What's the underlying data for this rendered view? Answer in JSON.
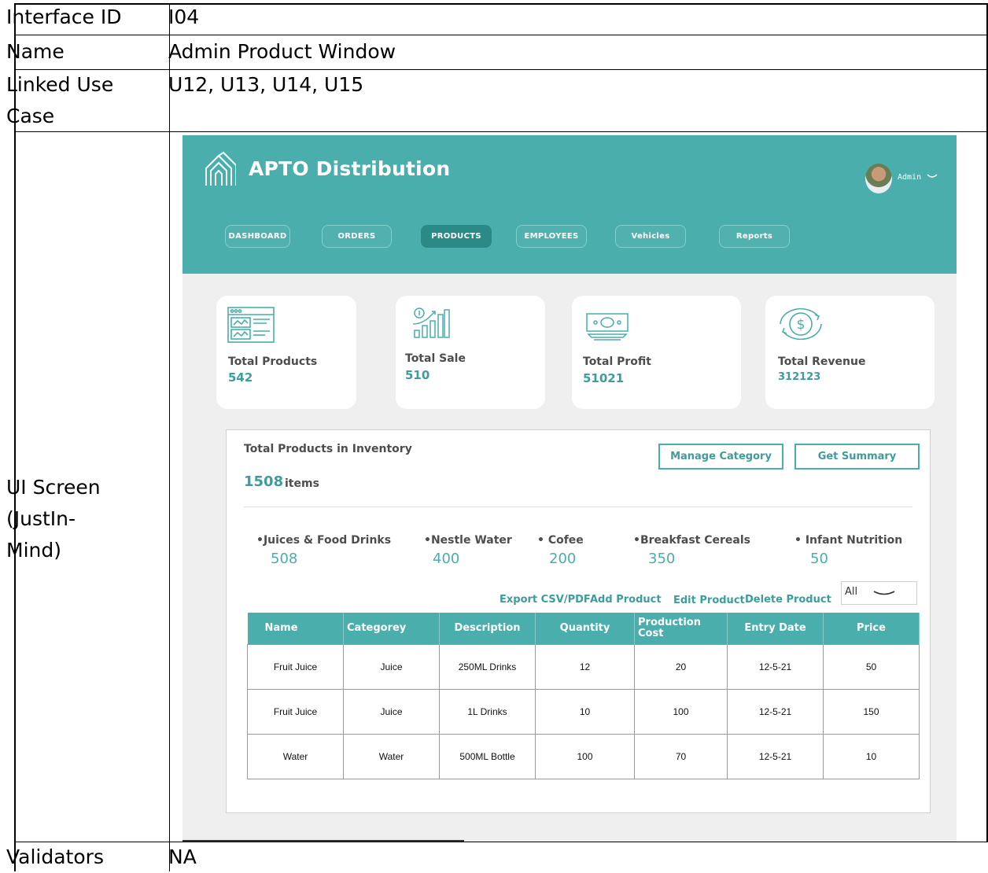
{
  "spec": {
    "rows": [
      {
        "label": "Interface ID",
        "value": "I04"
      },
      {
        "label": "Name",
        "value": "Admin Product Window"
      },
      {
        "label_line1": "Linked Use",
        "label_line2": "Case",
        "value": "U12, U13, U14, U15"
      },
      {
        "label_line1": "UI Screen",
        "label_line2": "(JustIn-",
        "label_line3": "Mind)"
      },
      {
        "label": "Validators",
        "value": "NA"
      }
    ]
  },
  "mockup": {
    "brand": "APTO Distribution",
    "user": "Admin",
    "nav": [
      "DASHBOARD",
      "ORDERS",
      "PRODUCTS",
      "EMPLOYEES",
      "Vehicles",
      "Reports"
    ],
    "active_nav": "PRODUCTS",
    "stats": [
      {
        "label": "Total Products",
        "value": "542",
        "icon": "dashboard-window-icon"
      },
      {
        "label": "Total Sale",
        "value": "510",
        "icon": "bar-growth-icon"
      },
      {
        "label": "Total Profit",
        "value": "51021",
        "icon": "cash-bill-icon"
      },
      {
        "label": "Total Revenue",
        "value": "312123",
        "icon": "dollar-cycle-icon"
      }
    ],
    "inventory": {
      "title": "Total Products in Inventory",
      "count": "1508",
      "count_unit": "items",
      "manage_category": "Manage Category",
      "get_summary": "Get Summary",
      "categories": [
        {
          "name": "•Juices & Food Drinks",
          "value": "508"
        },
        {
          "name": "•Nestle Water",
          "value": "400"
        },
        {
          "name": "• Cofee",
          "value": "200"
        },
        {
          "name": "•Breakfast Cereals",
          "value": "350"
        },
        {
          "name": "• Infant Nutrition",
          "value": "50"
        }
      ],
      "actions": {
        "export": "Export CSV/PDF",
        "add": "Add Product",
        "edit": "Edit Product",
        "delete": "Delete Product"
      },
      "filter_value": "All",
      "columns": [
        "Name",
        "Categorey",
        "Description",
        "Quantity",
        "Production Cost",
        "Entry Date",
        "Price"
      ],
      "rows": [
        [
          "Fruit Juice",
          "Juice",
          "250ML Drinks",
          "12",
          "20",
          "12-5-21",
          "50"
        ],
        [
          "Fruit Juice",
          "Juice",
          "1L Drinks",
          "10",
          "100",
          "12-5-21",
          "150"
        ],
        [
          "Water",
          "Water",
          "500ML Bottle",
          "100",
          "70",
          "12-5-21",
          "10"
        ]
      ]
    }
  },
  "colors": {
    "teal": "#4aaeac",
    "teal_dark": "#2b8a86",
    "teal_text": "#3d9d99",
    "bg": "#efefef"
  }
}
